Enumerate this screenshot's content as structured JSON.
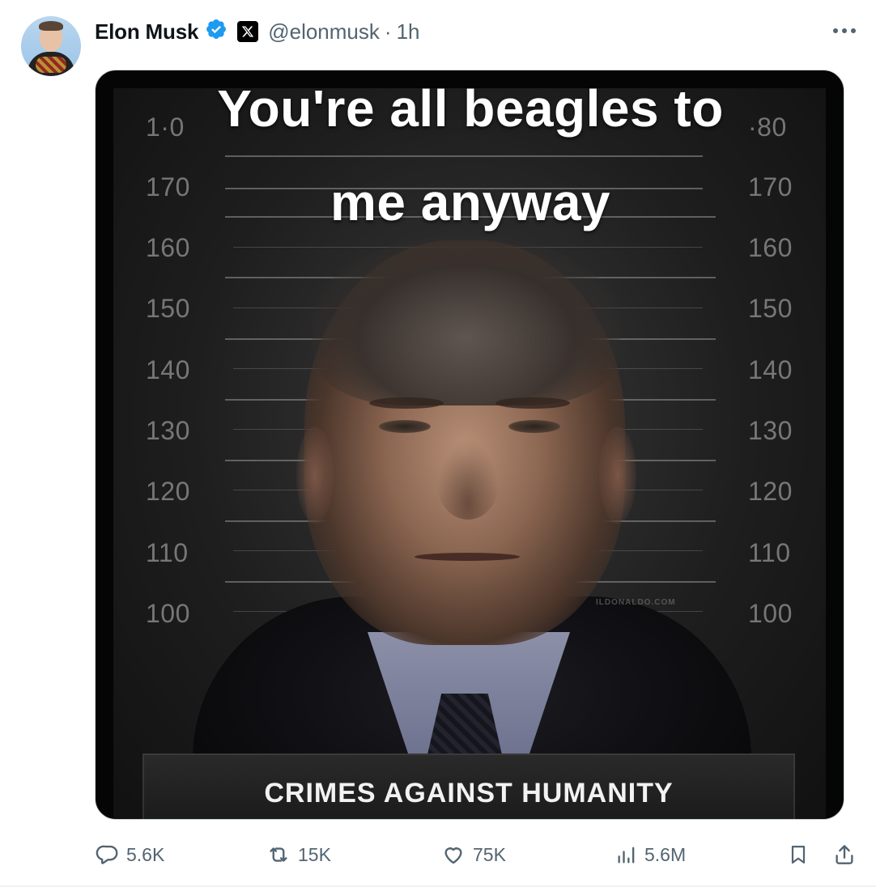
{
  "author": {
    "name": "Elon Musk",
    "handle": "@elonmusk",
    "separator": "·",
    "time": "1h",
    "avatar_icon": "profile-photo",
    "verified_icon": "verified-badge-icon",
    "affiliation_icon": "x-logo-icon"
  },
  "media": {
    "caption_line1": "You're all beagles to",
    "caption_line2": "me anyway",
    "height_marks": [
      "1·0",
      "170",
      "160",
      "150",
      "140",
      "130",
      "120",
      "110",
      "100"
    ],
    "height_marks_right": [
      "·80",
      "170",
      "160",
      "150",
      "140",
      "130",
      "120",
      "110",
      "100"
    ],
    "watermark": "ILDONALDO.COM",
    "plate_text": "CRIMES AGAINST HUMANITY"
  },
  "actions": {
    "replies": "5.6K",
    "reposts": "15K",
    "likes": "75K",
    "views": "5.6M"
  },
  "colors": {
    "verified": "#1d9bf0",
    "secondary_text": "#536471",
    "primary_text": "#0f1419"
  }
}
